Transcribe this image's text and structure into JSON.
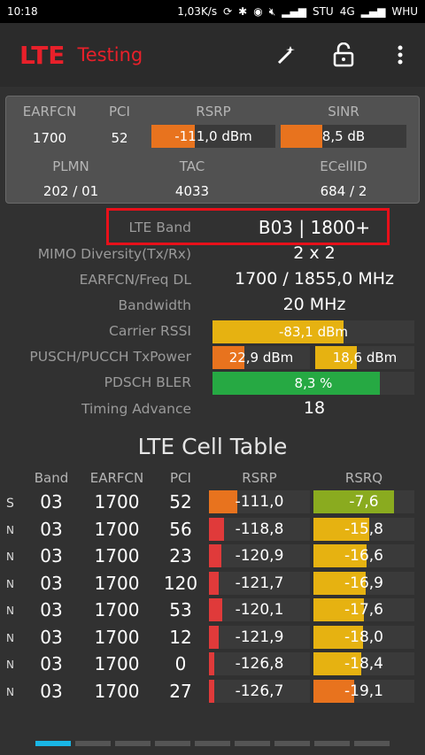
{
  "status": {
    "time": "10:18",
    "speed": "1,03K/s",
    "operator": "STU",
    "network": "4G",
    "carrier": "WHU"
  },
  "app": {
    "title_main": "LTE",
    "title_sub": "Testing",
    "icons": [
      "magic-wand-icon",
      "unlock-icon",
      "overflow-menu-icon"
    ]
  },
  "summary": {
    "earfcn": {
      "label": "EARFCN",
      "value": "1700"
    },
    "pci": {
      "label": "PCI",
      "value": "52"
    },
    "rsrp": {
      "label": "RSRP",
      "value": "-111,0 dBm",
      "fill": 0.35,
      "color": "#e8731e"
    },
    "sinr": {
      "label": "SINR",
      "value": "8,5 dB",
      "fill": 0.33,
      "color": "#e8731e"
    },
    "plmn": {
      "label": "PLMN",
      "value": "202 / 01"
    },
    "tac": {
      "label": "TAC",
      "value": "4033"
    },
    "ecellid": {
      "label": "ECellID",
      "value": "684 / 2"
    }
  },
  "info": {
    "band": {
      "label": "LTE Band",
      "value": "B03 | 1800+"
    },
    "mimo": {
      "label": "MIMO Diversity(Tx/Rx)",
      "value": "2 x 2"
    },
    "freq": {
      "label": "EARFCN/Freq DL",
      "value": "1700 / 1855,0 MHz"
    },
    "bandwidth": {
      "label": "Bandwidth",
      "value": "20 MHz"
    },
    "rssi": {
      "label": "Carrier RSSI",
      "value": "-83,1 dBm",
      "fill": 0.65,
      "color": "#e6b211"
    },
    "txpower": {
      "label": "PUSCH/PUCCH TxPower",
      "pusch": "22,9 dBm",
      "pusch_fill": 0.33,
      "pusch_color": "#e8731e",
      "pucch": "18,6 dBm",
      "pucch_fill": 0.42,
      "pucch_color": "#e6b211"
    },
    "bler": {
      "label": "PDSCH BLER",
      "value": "8,3 %",
      "fill": 0.83,
      "color": "#26a943"
    },
    "ta": {
      "label": "Timing Advance",
      "value": "18"
    }
  },
  "cell_table": {
    "title": "LTE Cell Table",
    "headers": {
      "band": "Band",
      "earfcn": "EARFCN",
      "pci": "PCI",
      "rsrp": "RSRP",
      "rsrq": "RSRQ"
    },
    "rows": [
      {
        "type": "S",
        "band": "03",
        "earfcn": "1700",
        "pci": "52",
        "rsrp": "-111,0",
        "rsrp_fill": 0.28,
        "rsrp_color": "#e8731e",
        "rsrq": "-7,6",
        "rsrq_fill": 0.8,
        "rsrq_color": "#8aab1f"
      },
      {
        "type": "N",
        "band": "03",
        "earfcn": "1700",
        "pci": "56",
        "rsrp": "-118,8",
        "rsrp_fill": 0.15,
        "rsrp_color": "#e03a3a",
        "rsrq": "-15,8",
        "rsrq_fill": 0.55,
        "rsrq_color": "#e6b211"
      },
      {
        "type": "N",
        "band": "03",
        "earfcn": "1700",
        "pci": "23",
        "rsrp": "-120,9",
        "rsrp_fill": 0.12,
        "rsrp_color": "#e03a3a",
        "rsrq": "-16,6",
        "rsrq_fill": 0.53,
        "rsrq_color": "#e6b211"
      },
      {
        "type": "N",
        "band": "03",
        "earfcn": "1700",
        "pci": "120",
        "rsrp": "-121,7",
        "rsrp_fill": 0.1,
        "rsrp_color": "#e03a3a",
        "rsrq": "-16,9",
        "rsrq_fill": 0.52,
        "rsrq_color": "#e6b211"
      },
      {
        "type": "N",
        "band": "03",
        "earfcn": "1700",
        "pci": "53",
        "rsrp": "-120,1",
        "rsrp_fill": 0.13,
        "rsrp_color": "#e03a3a",
        "rsrq": "-17,6",
        "rsrq_fill": 0.5,
        "rsrq_color": "#e6b211"
      },
      {
        "type": "N",
        "band": "03",
        "earfcn": "1700",
        "pci": "12",
        "rsrp": "-121,9",
        "rsrp_fill": 0.1,
        "rsrp_color": "#e03a3a",
        "rsrq": "-18,0",
        "rsrq_fill": 0.49,
        "rsrq_color": "#e6b211"
      },
      {
        "type": "N",
        "band": "03",
        "earfcn": "1700",
        "pci": "0",
        "rsrp": "-126,8",
        "rsrp_fill": 0.05,
        "rsrp_color": "#e03a3a",
        "rsrq": "-18,4",
        "rsrq_fill": 0.47,
        "rsrq_color": "#e6b211"
      },
      {
        "type": "N",
        "band": "03",
        "earfcn": "1700",
        "pci": "27",
        "rsrp": "-126,7",
        "rsrp_fill": 0.05,
        "rsrp_color": "#e03a3a",
        "rsrq": "-19,1",
        "rsrq_fill": 0.4,
        "rsrq_color": "#e8731e"
      }
    ]
  },
  "pager": {
    "pages": 9,
    "active": 1,
    "active_color": "#19b6e6"
  }
}
